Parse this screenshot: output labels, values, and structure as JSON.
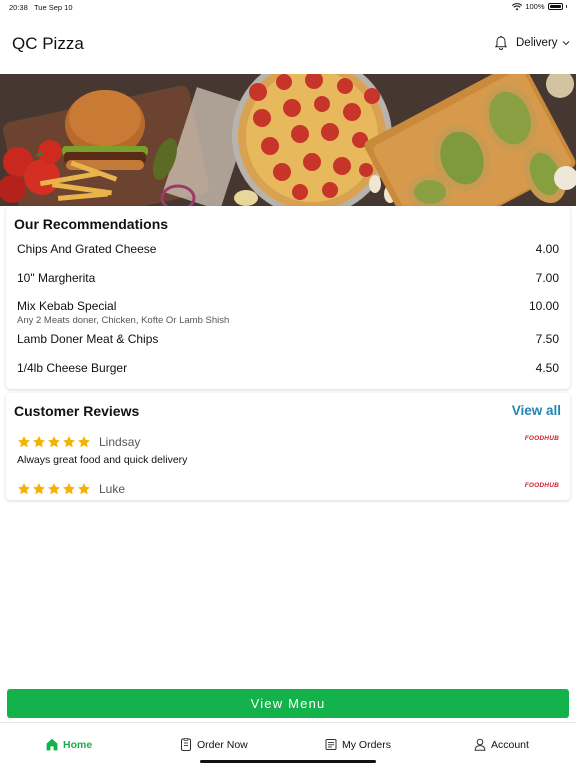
{
  "status_bar": {
    "time": "20:38",
    "date": "Tue Sep 10",
    "battery": "100%"
  },
  "header": {
    "title": "QC Pizza",
    "delivery_label": "Delivery"
  },
  "recommendations": {
    "title": "Our Recommendations",
    "items": [
      {
        "name": "Chips And Grated Cheese",
        "price": "4.00",
        "description": ""
      },
      {
        "name": "10\" Margherita",
        "price": "7.00",
        "description": ""
      },
      {
        "name": "Mix Kebab Special",
        "price": "10.00",
        "description": "Any 2 Meats doner, Chicken, Kofte Or Lamb Shish"
      },
      {
        "name": "Lamb Doner Meat & Chips",
        "price": "7.50",
        "description": ""
      },
      {
        "name": "1/4lb Cheese Burger",
        "price": "4.50",
        "description": ""
      }
    ]
  },
  "reviews": {
    "title": "Customer Reviews",
    "view_all_label": "View all",
    "items": [
      {
        "name": "Lindsay",
        "rating": 5,
        "text": "Always great food and quick delivery",
        "source": "FOODHUB"
      },
      {
        "name": "Luke",
        "rating": 5,
        "text": "",
        "source": "FOODHUB"
      }
    ]
  },
  "view_menu_label": "View Menu",
  "tabs": [
    {
      "label": "Home",
      "icon": "home-icon",
      "active": true
    },
    {
      "label": "Order Now",
      "icon": "order-icon",
      "active": false
    },
    {
      "label": "My Orders",
      "icon": "orders-list-icon",
      "active": false
    },
    {
      "label": "Account",
      "icon": "account-icon",
      "active": false
    }
  ],
  "colors": {
    "accent_green": "#13b24b",
    "link_blue": "#1f86b5",
    "star_yellow": "#f5b301",
    "foodhub_red": "#d32027"
  }
}
